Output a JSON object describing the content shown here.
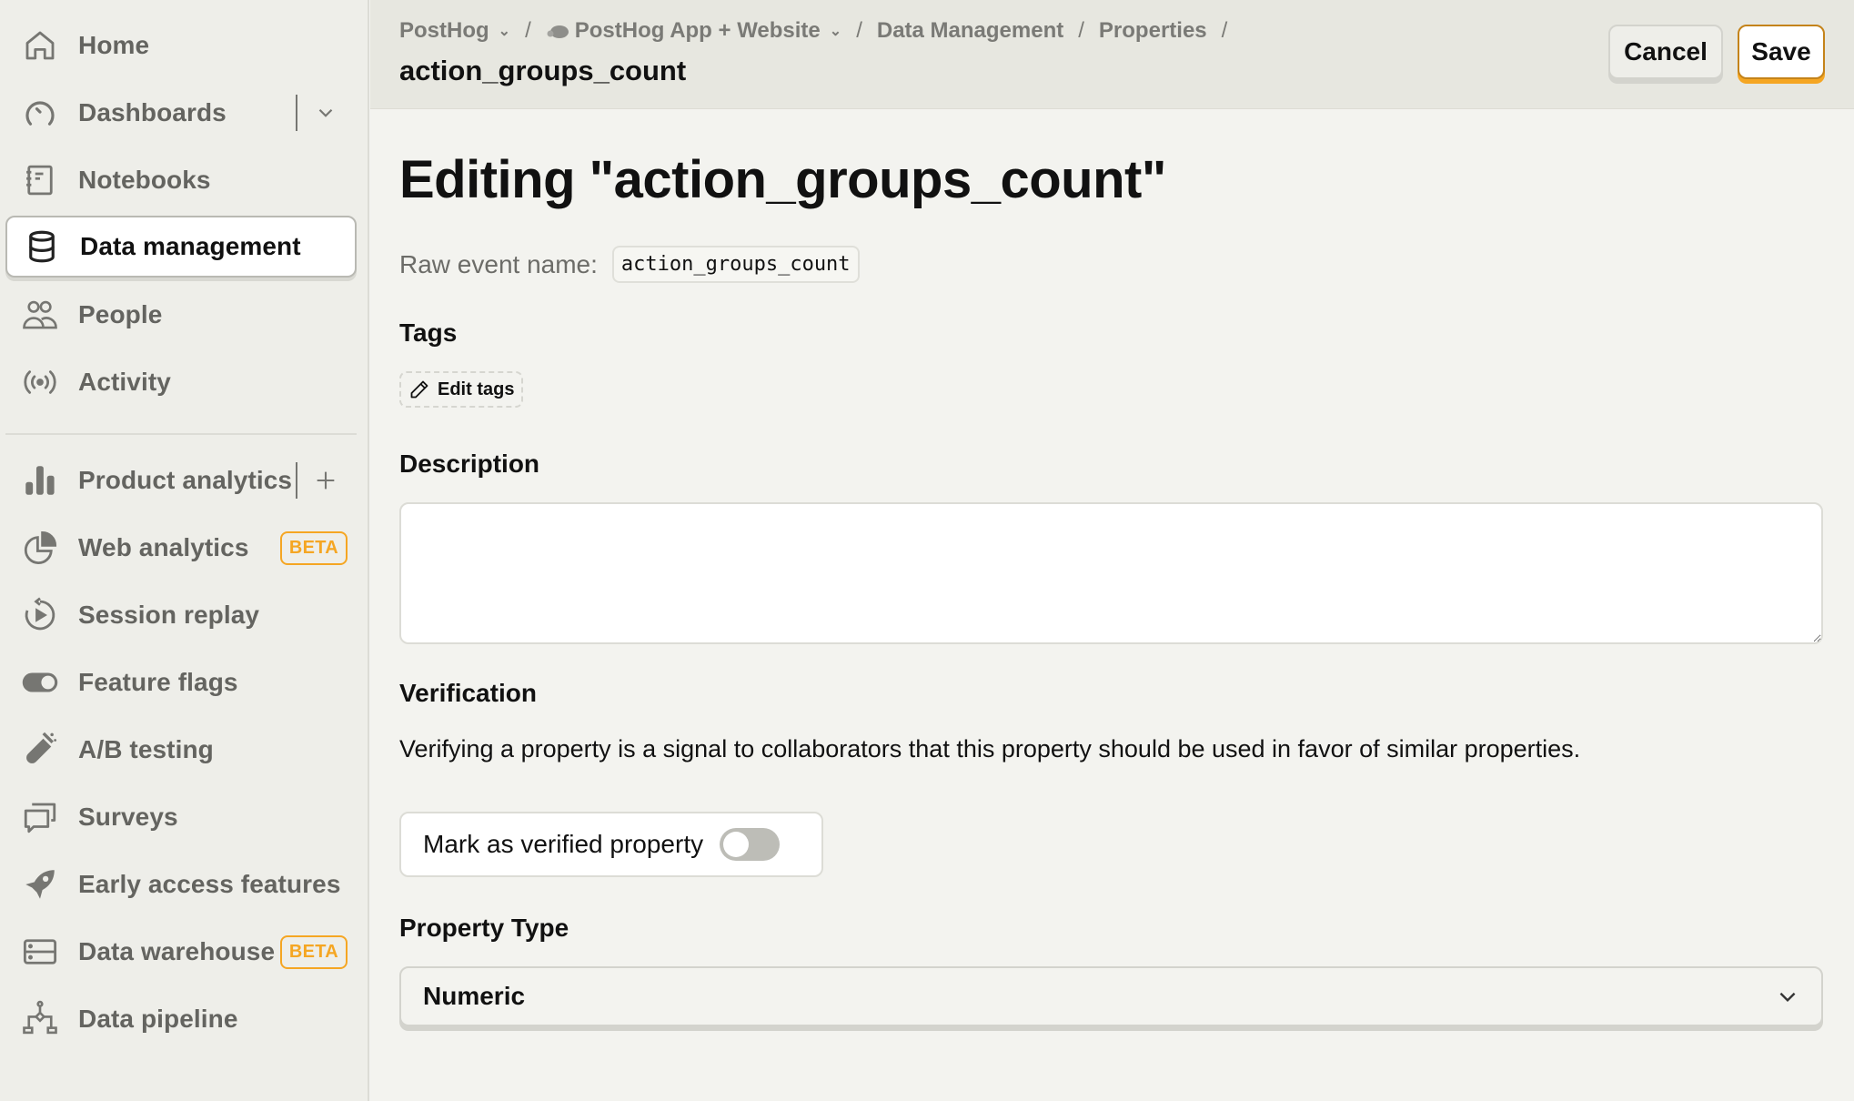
{
  "sidebar": {
    "items": [
      {
        "label": "Home",
        "icon": "home-icon"
      },
      {
        "label": "Dashboards",
        "icon": "dashboard-gauge-icon"
      },
      {
        "label": "Notebooks",
        "icon": "notebook-icon"
      },
      {
        "label": "Data management",
        "icon": "database-icon",
        "active": true
      },
      {
        "label": "People",
        "icon": "people-icon"
      },
      {
        "label": "Activity",
        "icon": "activity-broadcast-icon"
      },
      {
        "label": "Product analytics",
        "icon": "bar-chart-icon"
      },
      {
        "label": "Web analytics",
        "icon": "pie-chart-icon",
        "badge": "BETA"
      },
      {
        "label": "Session replay",
        "icon": "session-replay-icon"
      },
      {
        "label": "Feature flags",
        "icon": "toggle-icon"
      },
      {
        "label": "A/B testing",
        "icon": "flask-icon"
      },
      {
        "label": "Surveys",
        "icon": "chat-bubbles-icon"
      },
      {
        "label": "Early access features",
        "icon": "rocket-icon"
      },
      {
        "label": "Data warehouse",
        "icon": "server-icon",
        "badge": "BETA"
      },
      {
        "label": "Data pipeline",
        "icon": "pipeline-icon"
      }
    ],
    "badge_color": "#f5a623"
  },
  "header": {
    "breadcrumbs": [
      {
        "label": "PostHog",
        "dropdown": true
      },
      {
        "label": "PostHog App + Website",
        "dropdown": true,
        "icon": "hedgehog-icon"
      },
      {
        "label": "Data Management"
      },
      {
        "label": "Properties"
      }
    ],
    "title": "action_groups_count",
    "cancel_label": "Cancel",
    "save_label": "Save"
  },
  "main": {
    "editing_title": "Editing \"action_groups_count\"",
    "raw_event_label": "Raw event name:",
    "raw_event_value": "action_groups_count",
    "tags_heading": "Tags",
    "edit_tags_label": "Edit tags",
    "description_heading": "Description",
    "description_value": "",
    "verification_heading": "Verification",
    "verification_text": "Verifying a property is a signal to collaborators that this property should be used in favor of similar properties.",
    "verified_toggle_label": "Mark as verified property",
    "verified": false,
    "property_type_heading": "Property Type",
    "property_type_value": "Numeric"
  },
  "colors": {
    "accent": "#f5a623",
    "save_border": "#c4831a",
    "sidebar_bg": "#eeeee9",
    "content_bg": "#f3f3ef"
  }
}
